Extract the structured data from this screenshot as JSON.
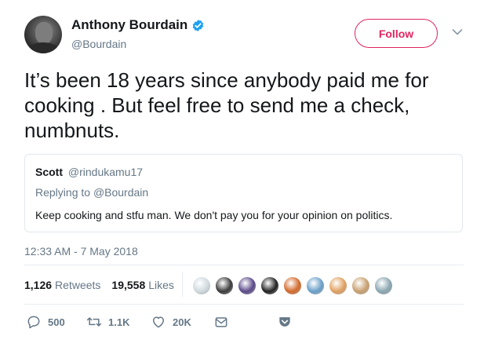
{
  "author": {
    "display_name": "Anthony Bourdain",
    "handle": "@Bourdain",
    "verified": true
  },
  "follow_button": {
    "label": "Follow"
  },
  "tweet": {
    "text": "It’s been 18 years since anybody paid me for cooking . But feel free to send me a check, numbnuts."
  },
  "quoted_tweet": {
    "name": "Scott",
    "handle": "@rindukamu17",
    "replying_prefix": "Replying to",
    "replying_to": "@Bourdain",
    "text": "Keep cooking and stfu man.  We don't pay you for your opinion on politics."
  },
  "timestamp": "12:33 AM - 7 May 2018",
  "stats": {
    "retweets_count": "1,126",
    "retweets_label": "Retweets",
    "likes_count": "19,558",
    "likes_label": "Likes"
  },
  "likers": [
    {
      "name": "liker-1",
      "color": "#cfd9de"
    },
    {
      "name": "liker-2",
      "color": "#3b3b3b"
    },
    {
      "name": "liker-3",
      "color": "#5b4a8a"
    },
    {
      "name": "liker-4",
      "color": "#222222"
    },
    {
      "name": "liker-5",
      "color": "#d2692a"
    },
    {
      "name": "liker-6",
      "color": "#6aa0c8"
    },
    {
      "name": "liker-7",
      "color": "#e0a060"
    },
    {
      "name": "liker-8",
      "color": "#c8a070"
    },
    {
      "name": "liker-9",
      "color": "#8aa6b0"
    }
  ],
  "actions": {
    "reply_count": "500",
    "retweet_count": "1.1K",
    "like_count": "20K"
  },
  "colors": {
    "accent": "#e0245e",
    "verified": "#1da1f2",
    "muted": "#657786"
  }
}
